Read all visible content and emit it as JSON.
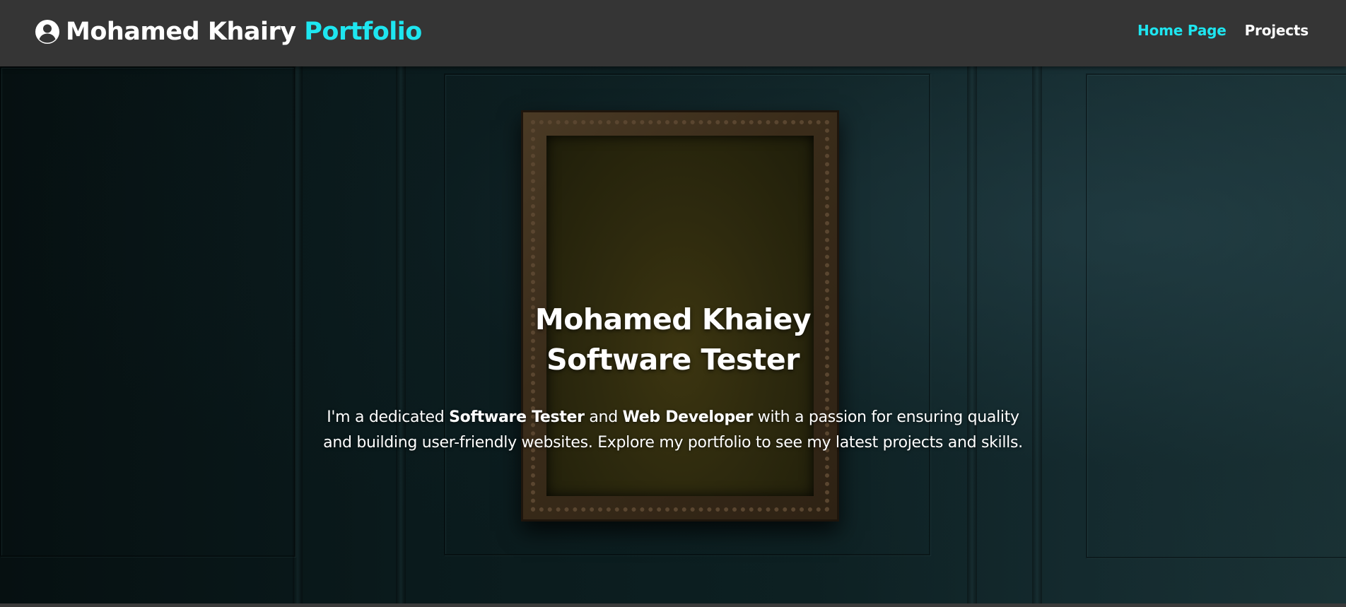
{
  "navbar": {
    "brand_icon": "user-circle-icon",
    "brand_name": "Mohamed Khairy",
    "brand_accent": "Portfolio",
    "links": [
      {
        "label": "Home Page",
        "active": true
      },
      {
        "label": "Projects",
        "active": false
      }
    ]
  },
  "hero": {
    "title_line1": "Mohamed Khaiey",
    "title_line2": "Software Tester",
    "desc_part1": "I'm a dedicated ",
    "desc_bold1": "Software Tester",
    "desc_part2": " and ",
    "desc_bold2": "Web Developer",
    "desc_part3": " with a passion for ensuring quality and building user-friendly websites. Explore my portfolio to see my latest projects and skills."
  },
  "colors": {
    "accent": "#1ee6f0",
    "navbar_bg": "#353535",
    "text": "#ffffff"
  }
}
